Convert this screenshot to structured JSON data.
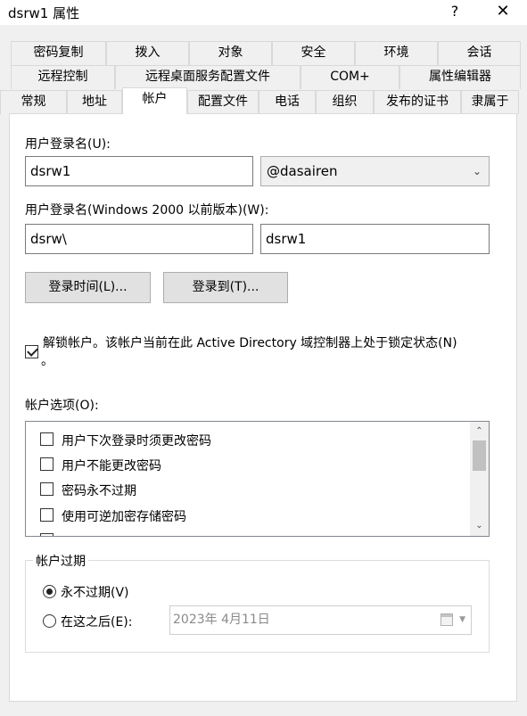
{
  "window": {
    "title": "dsrw1 属性",
    "help_label": "?",
    "close_label": "✕"
  },
  "tabs": {
    "row1": [
      "密码复制",
      "拨入",
      "对象",
      "安全",
      "环境",
      "会话"
    ],
    "row2": [
      "远程控制",
      "远程桌面服务配置文件",
      "COM+",
      "属性编辑器"
    ],
    "row3": [
      "常规",
      "地址",
      "帐户",
      "配置文件",
      "电话",
      "组织",
      "发布的证书",
      "隶属于"
    ],
    "active": "帐户"
  },
  "account": {
    "upn_label": "用户登录名(U):",
    "upn_value": "dsrw1",
    "domain_suffix": "@dasairen",
    "pre2000_label": "用户登录名(Windows 2000 以前版本)(W):",
    "pre2000_domain": "dsrw\\",
    "pre2000_user": "dsrw1",
    "logon_hours_button": "登录时间(L)...",
    "logon_to_button": "登录到(T)...",
    "unlock_label_line1": "解锁帐户。该帐户当前在此 Active Directory 域控制器上处于锁定状态(N)",
    "unlock_label_line2": "。",
    "unlock_checked": true
  },
  "options": {
    "label": "帐户选项(O):",
    "items": [
      {
        "label": "用户下次登录时须更改密码",
        "checked": false
      },
      {
        "label": "用户不能更改密码",
        "checked": false
      },
      {
        "label": "密码永不过期",
        "checked": false
      },
      {
        "label": "使用可逆加密存储密码",
        "checked": false
      }
    ]
  },
  "expiry": {
    "group_label": "帐户过期",
    "never_label": "永不过期(V)",
    "end_of_label": "在这之后(E):",
    "date_value": "2023年  4月11日",
    "selected": "never"
  },
  "icons": {
    "chevron": "chevron-down-icon",
    "calendar": "calendar-icon"
  }
}
